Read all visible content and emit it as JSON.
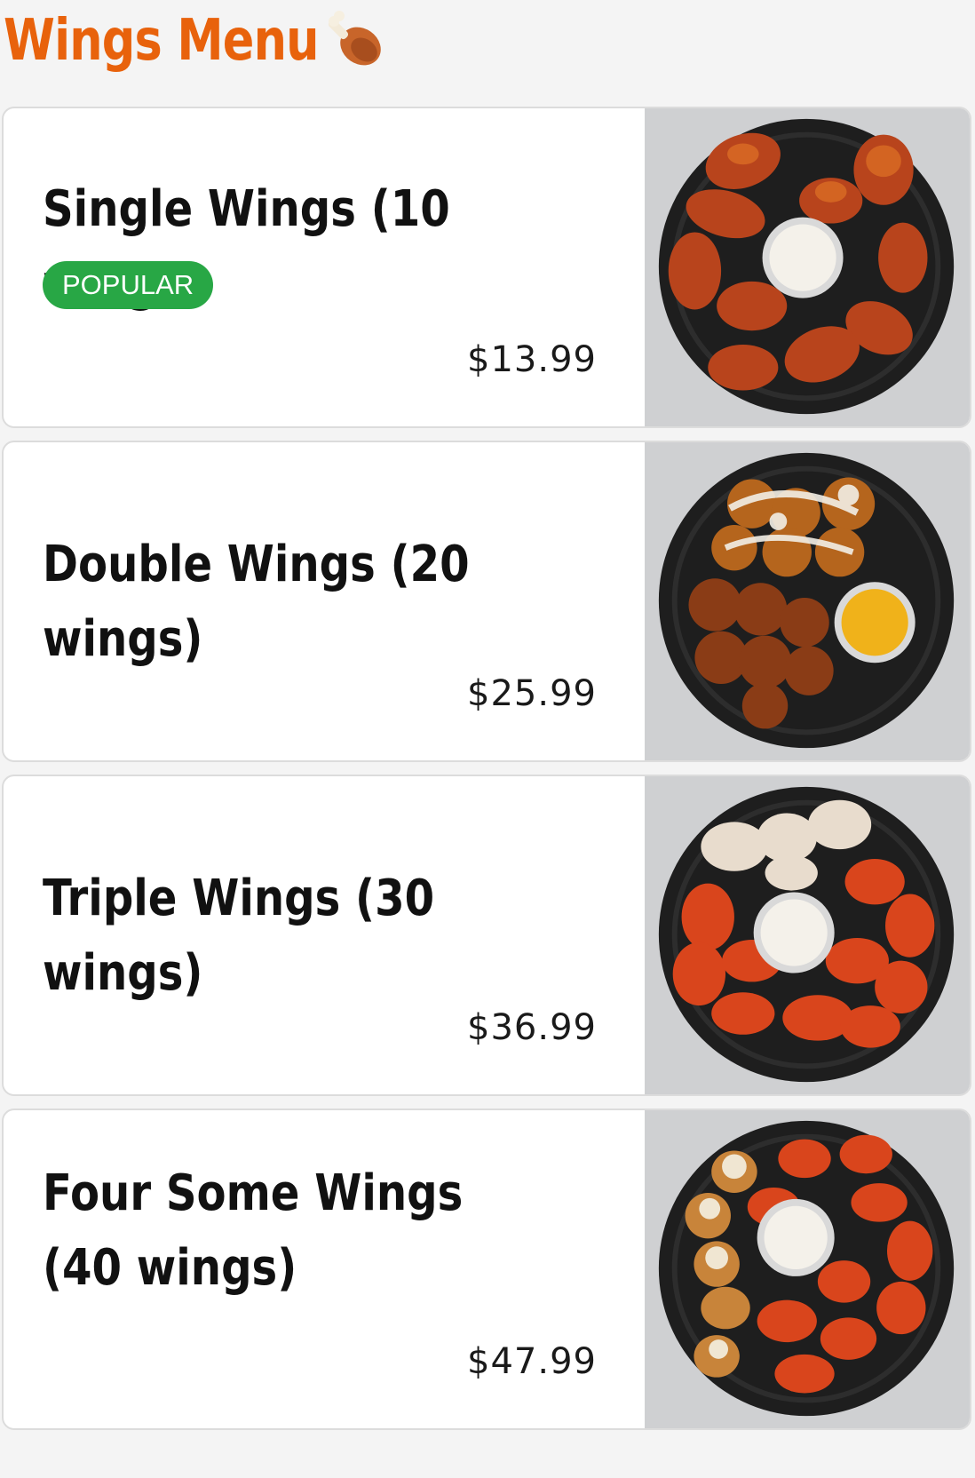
{
  "header": {
    "title": "Wings Menu",
    "icon": "drumstick-icon"
  },
  "items": [
    {
      "name": "Single Wings (10 wings)",
      "badge": "POPULAR",
      "price": "$13.99",
      "image": "wings-platter-ranch"
    },
    {
      "name": "Double Wings (20 wings)",
      "badge": "",
      "price": "$25.99",
      "image": "wings-platter-honey-mustard"
    },
    {
      "name": "Triple Wings (30 wings)",
      "badge": "",
      "price": "$36.99",
      "image": "wings-platter-buffalo-ranch"
    },
    {
      "name": "Four Some Wings (40 wings)",
      "badge": "",
      "price": "$47.99",
      "image": "wings-platter-mixed"
    }
  ],
  "colors": {
    "title": "#e8620c",
    "badge": "#28a745",
    "wing_red": "#c8401a",
    "wing_orange": "#d9691f",
    "wing_brown": "#9a4a1c",
    "plate": "#1e1e1e"
  }
}
